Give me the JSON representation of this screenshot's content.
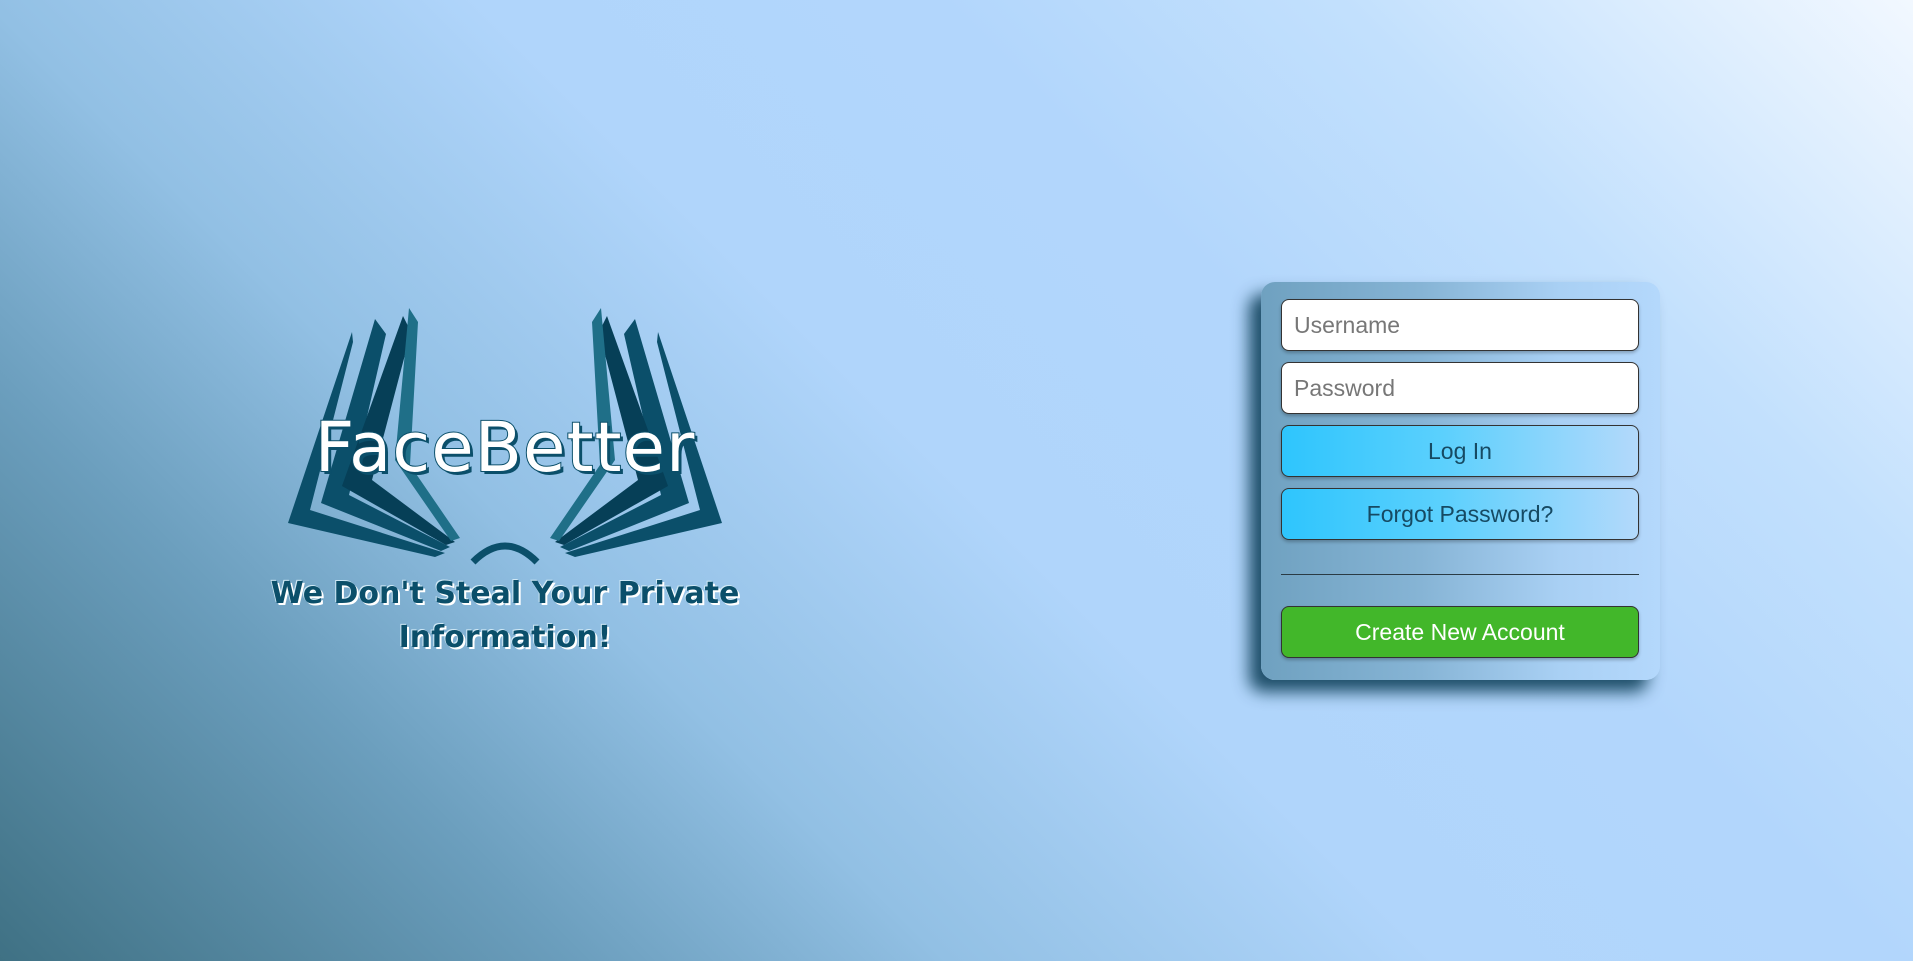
{
  "brand": {
    "name": "FaceBetter",
    "tagline": "We Don't Steal Your Private Information!",
    "icon": "open-book-icon",
    "colors": {
      "logo_dark": "#0b4f6a",
      "logo_mid": "#1f6f88"
    }
  },
  "login": {
    "username_placeholder": "Username",
    "username_value": "",
    "password_placeholder": "Password",
    "password_value": "",
    "login_label": "Log In",
    "forgot_label": "Forgot Password?",
    "create_label": "Create New Account"
  },
  "colors": {
    "accent_blue": "#2ec5fd",
    "create_green": "#42b72a",
    "background_light": "#b0d5fb",
    "background_dark": "#3f7184"
  }
}
